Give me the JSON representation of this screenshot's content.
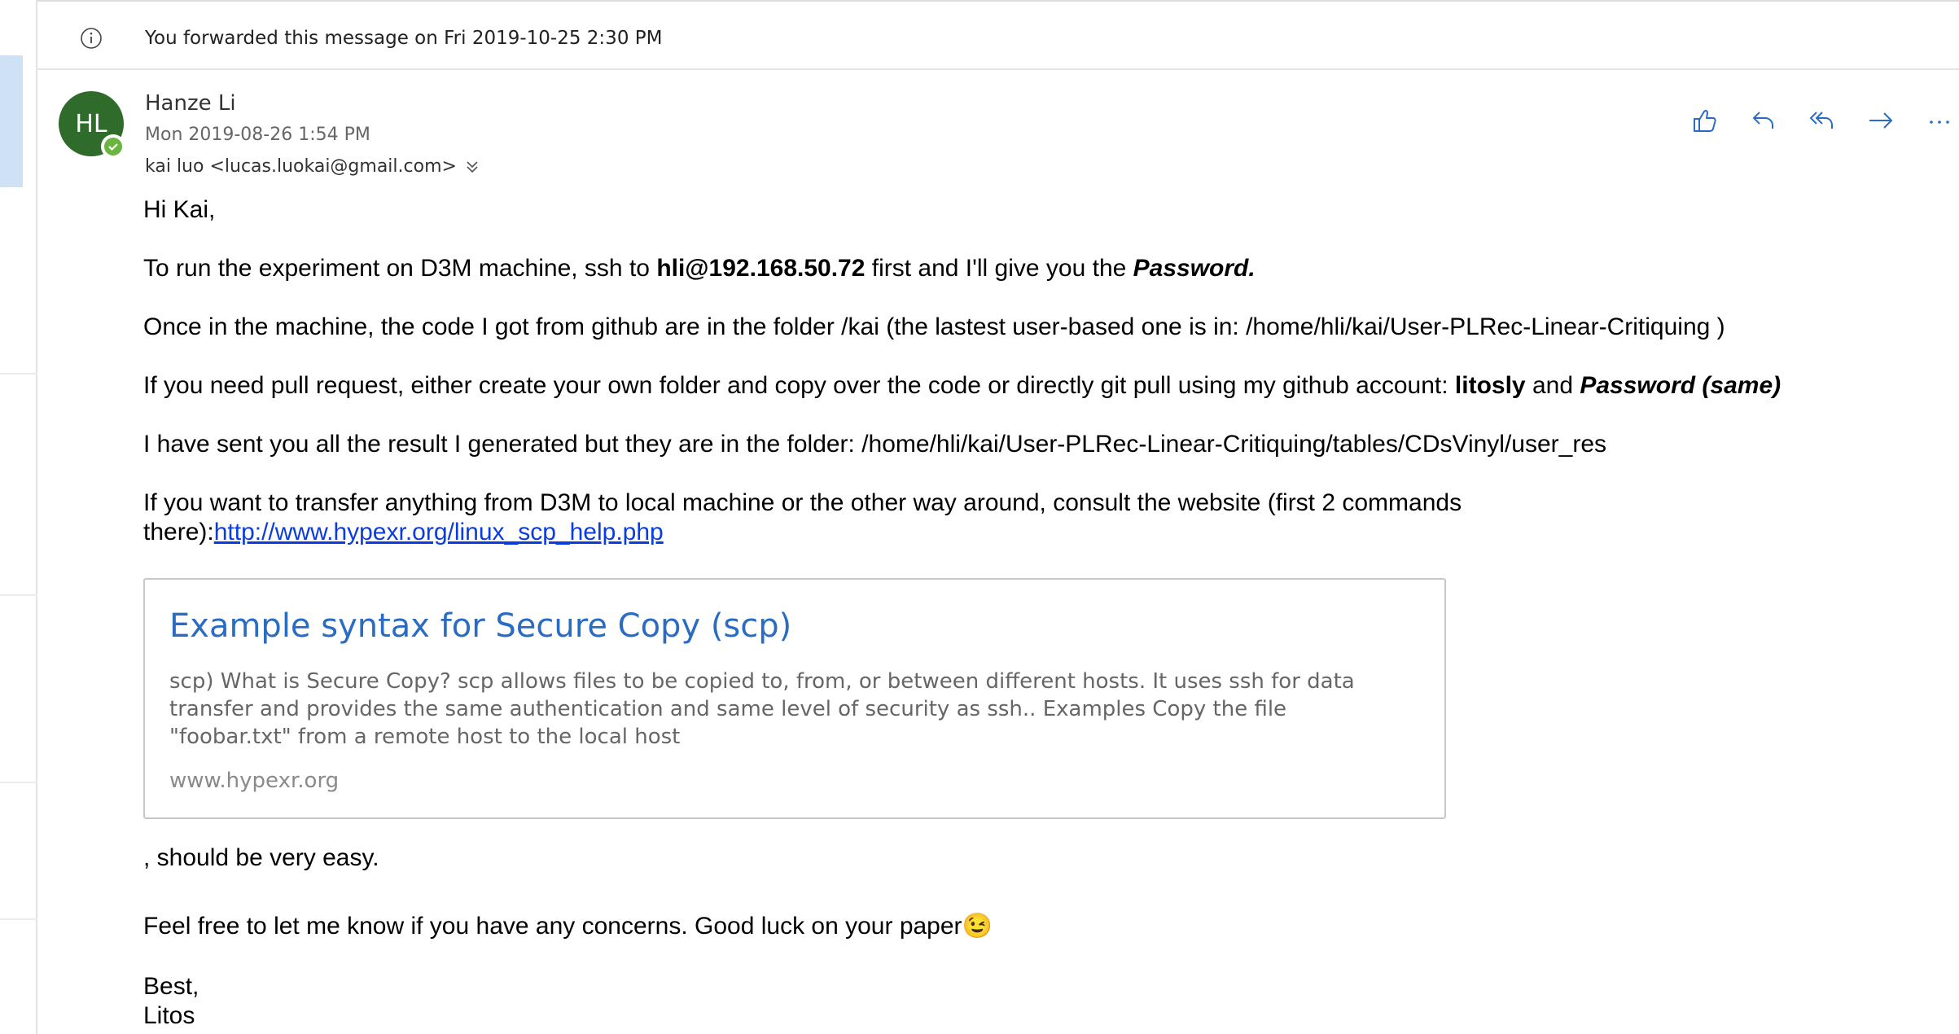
{
  "forward_notice": "You forwarded this message on Fri 2019-10-25 2:30 PM",
  "sender": {
    "initials": "HL",
    "name": "Hanze Li",
    "date": "Mon 2019-08-26 1:54 PM",
    "to": "kai luo <lucas.luokai@gmail.com>"
  },
  "icons": {
    "info": "info-icon",
    "like": "thumbs-up-icon",
    "reply": "reply-icon",
    "reply_all": "reply-all-icon",
    "forward": "forward-icon",
    "more": "more-icon",
    "expand": "chevron-double-down-icon"
  },
  "colors": {
    "accent": "#2a6cc4",
    "avatar": "#2f6b2a",
    "presence": "#6bb441",
    "link": "#0b3ce0"
  },
  "body": {
    "greeting": "Hi Kai,",
    "p1_a": "To run the experiment on D3M machine, ssh to ",
    "p1_b": "hli@192.168.50.72",
    "p1_c": " first and I'll give you the ",
    "p1_d": "Password.",
    "p2": "Once in the machine, the code I got from github are in the folder /kai (the lastest user-based one is in: /home/hli/kai/User-PLRec-Linear-Critiquing )",
    "p3_a": "If you need pull request, either create your own folder and copy over the code or directly git pull using my github account: ",
    "p3_b": "litosly",
    "p3_c": " and ",
    "p3_d": "Password (same)",
    "p4": "I have  sent you all the result I generated but they are in the folder: /home/hli/kai/User-PLRec-Linear-Critiquing/tables/CDsVinyl/user_res",
    "p5_line1": "If  you want to transfer anything from D3M  to local machine or the other way around, consult the website (first 2 commands",
    "p5_line2": "there):",
    "p5_link": "http://www.hypexr.org/linux_scp_help.php",
    "after_card": ", should be very easy.",
    "p6": "Feel free to let me know if you have  any concerns. Good luck on your paper",
    "p6_emoji": "😉",
    "sign1": "Best,",
    "sign2": "Litos"
  },
  "link_card": {
    "title": "Example syntax for Secure Copy (scp)",
    "description": "scp) What is Secure Copy? scp allows files to be copied to, from, or between different hosts. It uses ssh for data transfer and provides the same authentication and same level of security as ssh.. Examples Copy the file \"foobar.txt\" from a remote host to the local host",
    "host": "www.hypexr.org"
  }
}
